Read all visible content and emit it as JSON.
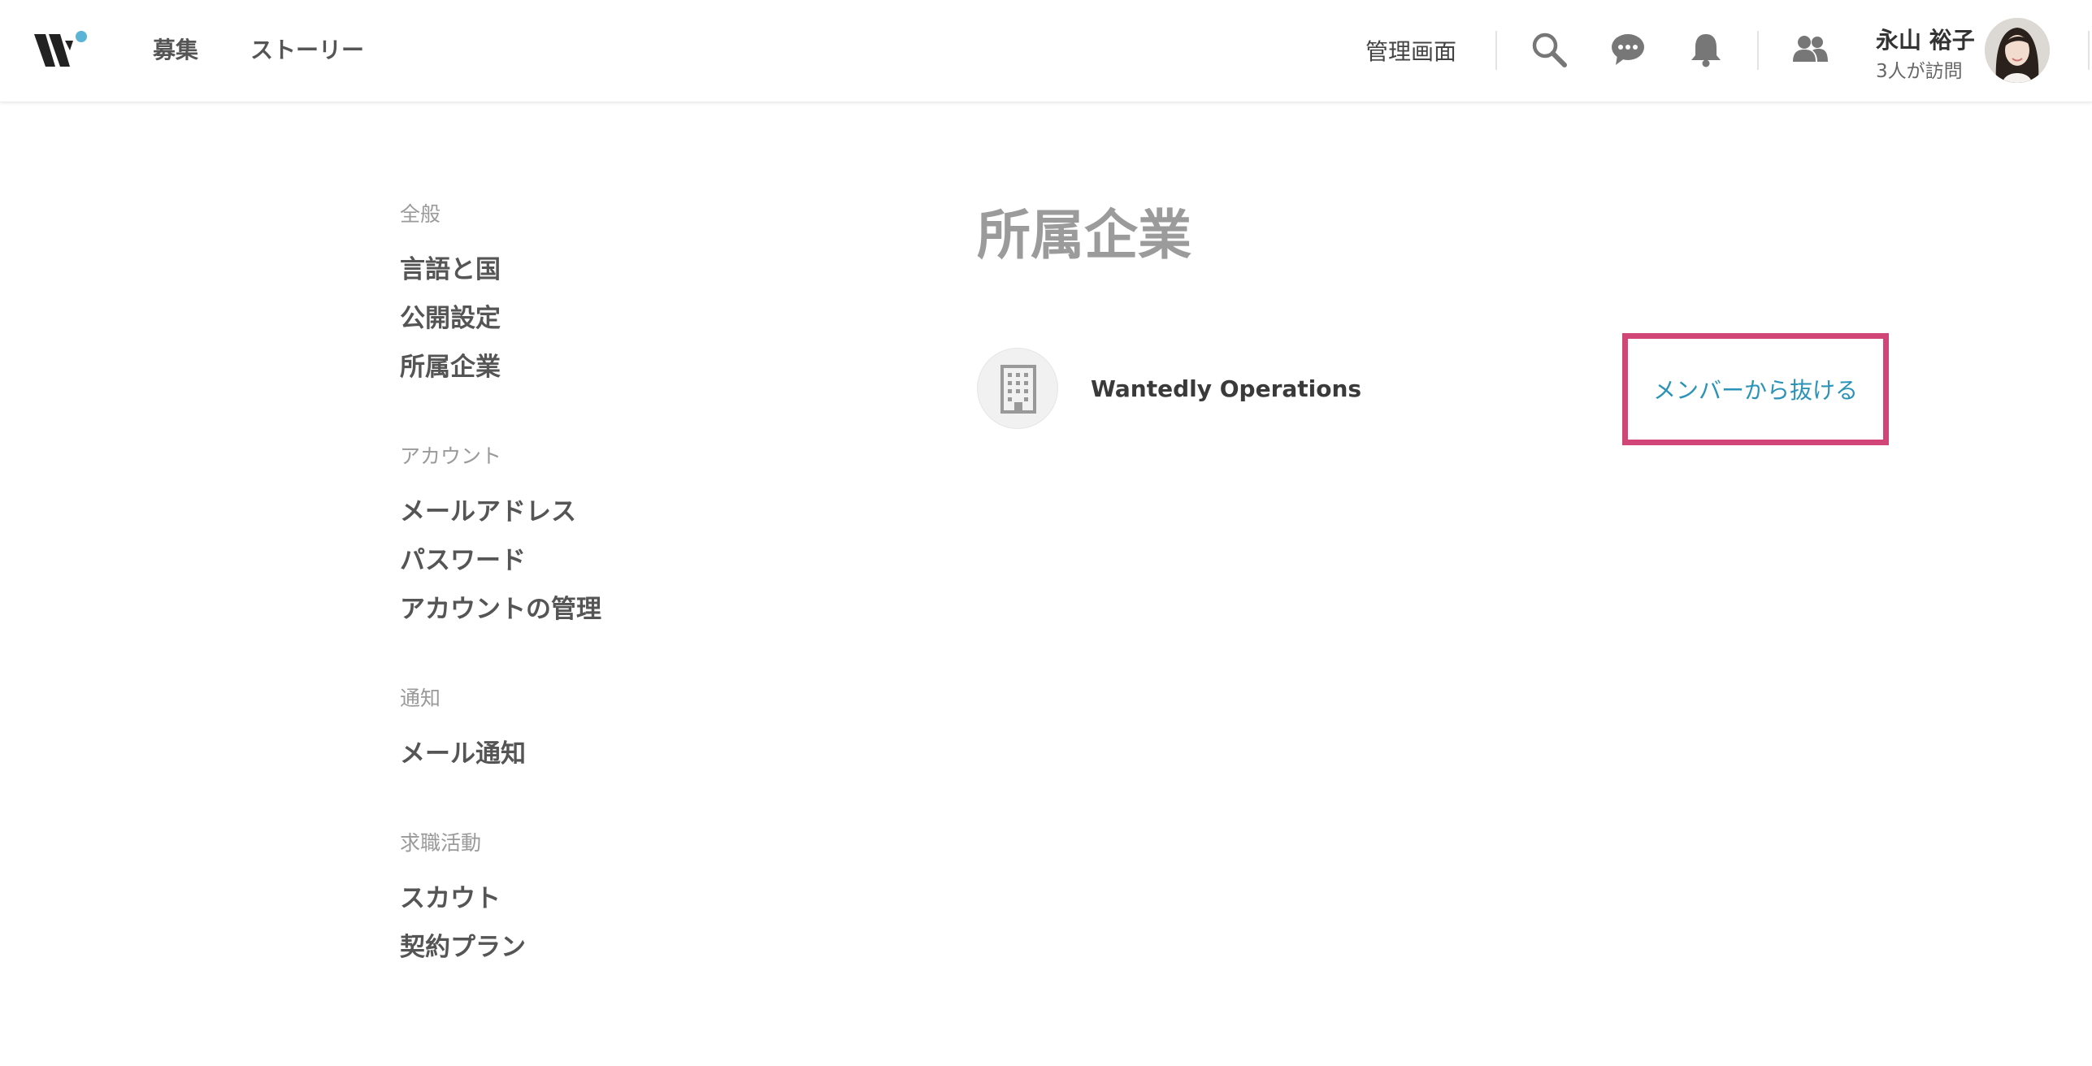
{
  "header": {
    "nav": {
      "recruit": "募集",
      "story": "ストーリー"
    },
    "admin_link": "管理画面",
    "icons": [
      "search-icon",
      "chat-icon",
      "bell-icon",
      "people-icon"
    ],
    "user": {
      "name": "永山 裕子",
      "visits": "3人が訪問"
    },
    "logo_accent_color": "#5bb3d6"
  },
  "sidebar": {
    "general": {
      "title": "全般",
      "items": [
        "言語と国",
        "公開設定",
        "所属企業"
      ]
    },
    "account": {
      "title": "アカウント",
      "items": [
        "メールアドレス",
        "パスワード",
        "アカウントの管理"
      ]
    },
    "notification": {
      "title": "通知",
      "items": [
        "メール通知"
      ]
    },
    "job_search": {
      "title": "求職活動",
      "items": [
        "スカウト",
        "契約プラン"
      ]
    }
  },
  "main": {
    "title": "所属企業",
    "company": {
      "name": "Wantedly Operations",
      "icon": "building-icon"
    },
    "leave_button": "メンバーから抜ける",
    "highlight_color": "#d14577",
    "link_color": "#2a93b7"
  }
}
